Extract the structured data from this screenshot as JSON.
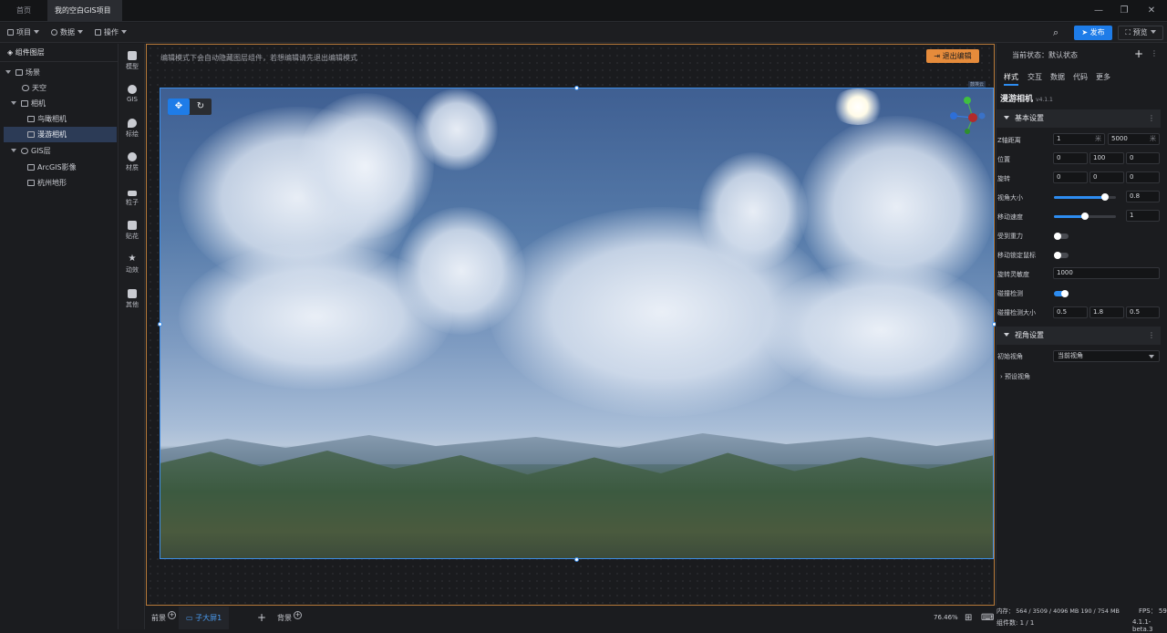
{
  "titlebar": {
    "tabs": [
      {
        "label": "首页"
      },
      {
        "label": "我的空白GIS项目"
      }
    ]
  },
  "toolbar": {
    "items": [
      {
        "label": "项目"
      },
      {
        "label": "数据"
      },
      {
        "label": "操作"
      }
    ],
    "publish": "发布",
    "preview": "预览"
  },
  "layers": {
    "header": "组件图层",
    "items": [
      {
        "label": "场景"
      },
      {
        "label": "天空"
      },
      {
        "label": "相机"
      },
      {
        "label": "鸟瞰相机"
      },
      {
        "label": "漫游相机"
      },
      {
        "label": "GIS层"
      },
      {
        "label": "ArcGIS影像"
      },
      {
        "label": "杭州地形"
      }
    ]
  },
  "strip": {
    "items": [
      {
        "label": "模型"
      },
      {
        "label": "GIS"
      },
      {
        "label": "标绘"
      },
      {
        "label": "材质"
      },
      {
        "label": "粒子"
      },
      {
        "label": "贴花"
      },
      {
        "label": "动效"
      },
      {
        "label": "其他"
      }
    ]
  },
  "canvas": {
    "hint": "编辑模式下会自动隐藏图层组件，若想编辑请先退出编辑模式",
    "exit": "退出编辑",
    "corner_label": "鼓埃云"
  },
  "bottom": {
    "front": "前景",
    "child": "子大屏1",
    "back": "背景",
    "zoom": "76.46%"
  },
  "right": {
    "state": "当前状态：默认状态",
    "tabs": [
      {
        "label": "样式"
      },
      {
        "label": "交互"
      },
      {
        "label": "数据"
      },
      {
        "label": "代码"
      },
      {
        "label": "更多"
      }
    ],
    "component": "漫游相机",
    "version": "v4.1.1",
    "basic_header": "基本设置",
    "fields": {
      "z_label": "Z轴距离",
      "z_min": "1",
      "z_max": "5000",
      "unit": "米",
      "pos_label": "位置",
      "pos": [
        "0",
        "100",
        "0"
      ],
      "rot_label": "旋转",
      "rot": [
        "0",
        "0",
        "0"
      ],
      "fov_label": "视角大小",
      "fov": "0.8",
      "speed_label": "移动速度",
      "speed": "1",
      "gravity_label": "受到重力",
      "lockmouse_label": "移动锁定鼠标",
      "rotsens_label": "旋转灵敏度",
      "rotsens": "1000",
      "collide_label": "碰撞检测",
      "csize_label": "碰撞检测大小",
      "csize": [
        "0.5",
        "1.8",
        "0.5"
      ]
    },
    "view_header": "视角设置",
    "initview_label": "初始视角",
    "initview_value": "当前视角",
    "preset_label": "预设视角"
  },
  "status": {
    "memory": "内存： 564 / 3509 / 4096 MB  190 / 754 MB",
    "fps": "FPS： 59",
    "count": "组件数: 1 / 1",
    "ver": "4.1.1-beta.3"
  },
  "colors": {
    "accent": "#1e7ce8",
    "exit": "#e58b3b",
    "selection": "#3d8ee8"
  }
}
